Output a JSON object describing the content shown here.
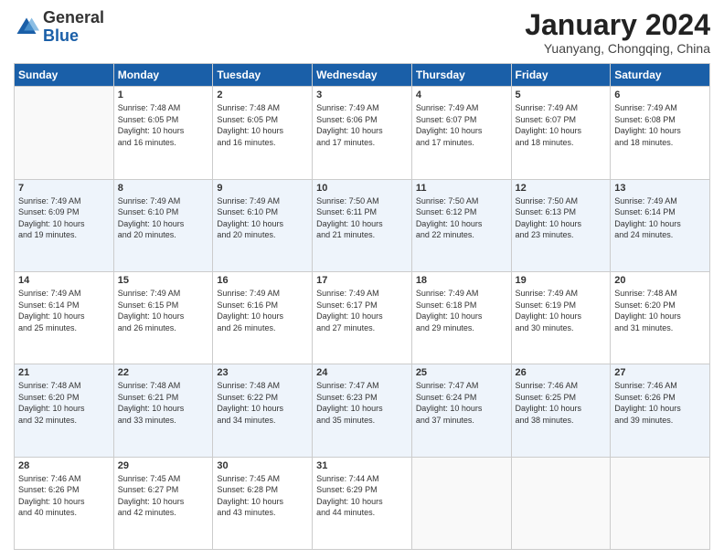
{
  "logo": {
    "general": "General",
    "blue": "Blue"
  },
  "header": {
    "month": "January 2024",
    "location": "Yuanyang, Chongqing, China"
  },
  "days_of_week": [
    "Sunday",
    "Monday",
    "Tuesday",
    "Wednesday",
    "Thursday",
    "Friday",
    "Saturday"
  ],
  "weeks": [
    [
      {
        "day": "",
        "info": ""
      },
      {
        "day": "1",
        "info": "Sunrise: 7:48 AM\nSunset: 6:05 PM\nDaylight: 10 hours\nand 16 minutes."
      },
      {
        "day": "2",
        "info": "Sunrise: 7:48 AM\nSunset: 6:05 PM\nDaylight: 10 hours\nand 16 minutes."
      },
      {
        "day": "3",
        "info": "Sunrise: 7:49 AM\nSunset: 6:06 PM\nDaylight: 10 hours\nand 17 minutes."
      },
      {
        "day": "4",
        "info": "Sunrise: 7:49 AM\nSunset: 6:07 PM\nDaylight: 10 hours\nand 17 minutes."
      },
      {
        "day": "5",
        "info": "Sunrise: 7:49 AM\nSunset: 6:07 PM\nDaylight: 10 hours\nand 18 minutes."
      },
      {
        "day": "6",
        "info": "Sunrise: 7:49 AM\nSunset: 6:08 PM\nDaylight: 10 hours\nand 18 minutes."
      }
    ],
    [
      {
        "day": "7",
        "info": "Sunrise: 7:49 AM\nSunset: 6:09 PM\nDaylight: 10 hours\nand 19 minutes."
      },
      {
        "day": "8",
        "info": "Sunrise: 7:49 AM\nSunset: 6:10 PM\nDaylight: 10 hours\nand 20 minutes."
      },
      {
        "day": "9",
        "info": "Sunrise: 7:49 AM\nSunset: 6:10 PM\nDaylight: 10 hours\nand 20 minutes."
      },
      {
        "day": "10",
        "info": "Sunrise: 7:50 AM\nSunset: 6:11 PM\nDaylight: 10 hours\nand 21 minutes."
      },
      {
        "day": "11",
        "info": "Sunrise: 7:50 AM\nSunset: 6:12 PM\nDaylight: 10 hours\nand 22 minutes."
      },
      {
        "day": "12",
        "info": "Sunrise: 7:50 AM\nSunset: 6:13 PM\nDaylight: 10 hours\nand 23 minutes."
      },
      {
        "day": "13",
        "info": "Sunrise: 7:49 AM\nSunset: 6:14 PM\nDaylight: 10 hours\nand 24 minutes."
      }
    ],
    [
      {
        "day": "14",
        "info": "Sunrise: 7:49 AM\nSunset: 6:14 PM\nDaylight: 10 hours\nand 25 minutes."
      },
      {
        "day": "15",
        "info": "Sunrise: 7:49 AM\nSunset: 6:15 PM\nDaylight: 10 hours\nand 26 minutes."
      },
      {
        "day": "16",
        "info": "Sunrise: 7:49 AM\nSunset: 6:16 PM\nDaylight: 10 hours\nand 26 minutes."
      },
      {
        "day": "17",
        "info": "Sunrise: 7:49 AM\nSunset: 6:17 PM\nDaylight: 10 hours\nand 27 minutes."
      },
      {
        "day": "18",
        "info": "Sunrise: 7:49 AM\nSunset: 6:18 PM\nDaylight: 10 hours\nand 29 minutes."
      },
      {
        "day": "19",
        "info": "Sunrise: 7:49 AM\nSunset: 6:19 PM\nDaylight: 10 hours\nand 30 minutes."
      },
      {
        "day": "20",
        "info": "Sunrise: 7:48 AM\nSunset: 6:20 PM\nDaylight: 10 hours\nand 31 minutes."
      }
    ],
    [
      {
        "day": "21",
        "info": "Sunrise: 7:48 AM\nSunset: 6:20 PM\nDaylight: 10 hours\nand 32 minutes."
      },
      {
        "day": "22",
        "info": "Sunrise: 7:48 AM\nSunset: 6:21 PM\nDaylight: 10 hours\nand 33 minutes."
      },
      {
        "day": "23",
        "info": "Sunrise: 7:48 AM\nSunset: 6:22 PM\nDaylight: 10 hours\nand 34 minutes."
      },
      {
        "day": "24",
        "info": "Sunrise: 7:47 AM\nSunset: 6:23 PM\nDaylight: 10 hours\nand 35 minutes."
      },
      {
        "day": "25",
        "info": "Sunrise: 7:47 AM\nSunset: 6:24 PM\nDaylight: 10 hours\nand 37 minutes."
      },
      {
        "day": "26",
        "info": "Sunrise: 7:46 AM\nSunset: 6:25 PM\nDaylight: 10 hours\nand 38 minutes."
      },
      {
        "day": "27",
        "info": "Sunrise: 7:46 AM\nSunset: 6:26 PM\nDaylight: 10 hours\nand 39 minutes."
      }
    ],
    [
      {
        "day": "28",
        "info": "Sunrise: 7:46 AM\nSunset: 6:26 PM\nDaylight: 10 hours\nand 40 minutes."
      },
      {
        "day": "29",
        "info": "Sunrise: 7:45 AM\nSunset: 6:27 PM\nDaylight: 10 hours\nand 42 minutes."
      },
      {
        "day": "30",
        "info": "Sunrise: 7:45 AM\nSunset: 6:28 PM\nDaylight: 10 hours\nand 43 minutes."
      },
      {
        "day": "31",
        "info": "Sunrise: 7:44 AM\nSunset: 6:29 PM\nDaylight: 10 hours\nand 44 minutes."
      },
      {
        "day": "",
        "info": ""
      },
      {
        "day": "",
        "info": ""
      },
      {
        "day": "",
        "info": ""
      }
    ]
  ]
}
